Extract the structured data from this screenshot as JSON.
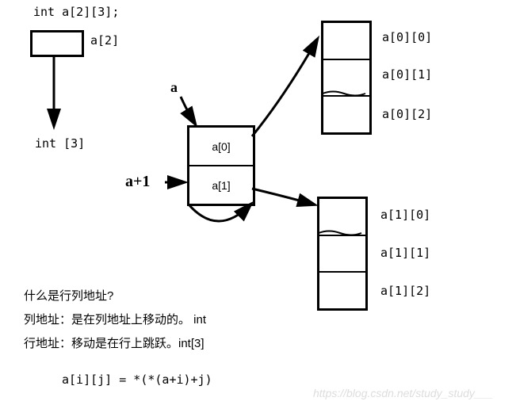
{
  "decl": "int a[2][3];",
  "a2_label": "a[2]",
  "int3_label": "int [3]",
  "ptr_a": "a",
  "ptr_a1": "a+1",
  "mid_cells": [
    "a[0]",
    "a[1]"
  ],
  "top_right_cells": [
    "a[0][0]",
    "a[0][1]",
    "a[0][2]"
  ],
  "bot_right_cells": [
    "a[1][0]",
    "a[1][1]",
    "a[1][2]"
  ],
  "q_title": "什么是行列地址?",
  "q_col": "列地址：是在列地址上移动的。  int",
  "q_row": "行地址：移动是在行上跳跃。int[3]",
  "formula": "a[i][j] = *(*(a+i)+j)",
  "watermark": "https://blog.csdn.net/study_study___"
}
